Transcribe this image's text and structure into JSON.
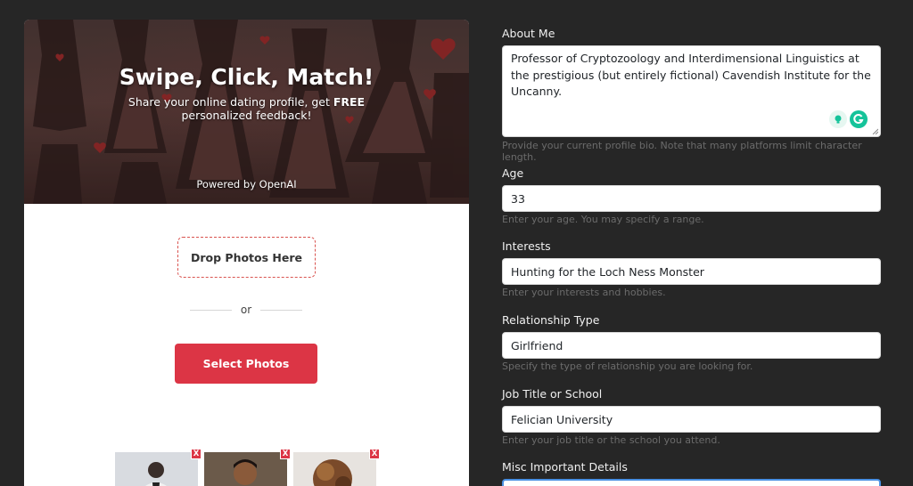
{
  "hero": {
    "title": "Swipe, Click, Match!",
    "subtitle_prefix": "Share your online dating profile, get ",
    "subtitle_bold": "FREE",
    "subtitle_suffix": "personalized feedback!",
    "powered_by": "Powered by OpenAI"
  },
  "upload": {
    "drop_label": "Drop Photos Here",
    "or_text": "or",
    "select_label": "Select Photos",
    "remove_label": "X",
    "thumbnails": [
      {
        "icon": "photo-thumbnail",
        "alt": "photo 1"
      },
      {
        "icon": "photo-thumbnail",
        "alt": "photo 2"
      },
      {
        "icon": "photo-thumbnail",
        "alt": "photo 3"
      }
    ]
  },
  "form": {
    "about": {
      "label": "About Me",
      "value": "Professor of Cryptozoology and Interdimensional Linguistics at the prestigious (but entirely fictional) Cavendish Institute for the Uncanny.",
      "help": "Provide your current profile bio. Note that many platforms limit character length."
    },
    "age": {
      "label": "Age",
      "value": "33",
      "help": "Enter your age. You may specify a range."
    },
    "interests": {
      "label": "Interests",
      "value": "Hunting for the Loch Ness Monster",
      "help": "Enter your interests and hobbies."
    },
    "relationship": {
      "label": "Relationship Type",
      "value": "Girlfriend",
      "help": "Specify the type of relationship you are looking for."
    },
    "job": {
      "label": "Job Title or School",
      "value": "Felician University",
      "help": "Enter your job title or the school you attend."
    },
    "misc": {
      "label": "Misc Important Details",
      "value": ""
    }
  },
  "colors": {
    "background": "#262626",
    "accent": "#dc3545",
    "focus": "#4a90e2",
    "grammarly": "#15c39a"
  }
}
